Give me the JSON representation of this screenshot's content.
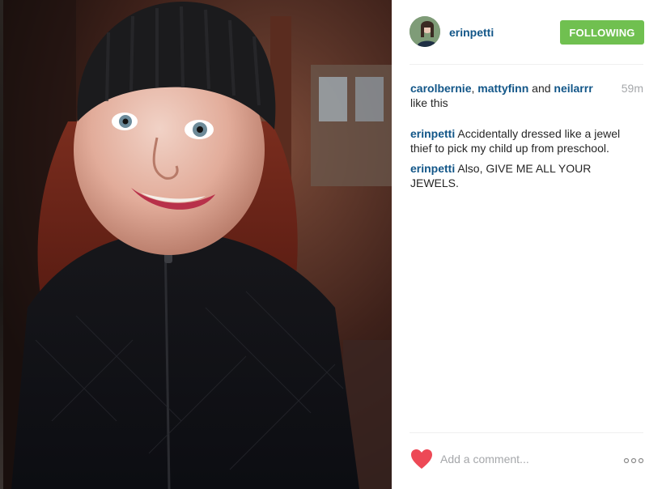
{
  "post": {
    "photo_alt": "Selfie",
    "colors": {
      "link": "#125688",
      "follow_bg": "#70c050",
      "heart": "#ed4956",
      "muted": "#a5a7aa"
    }
  },
  "header": {
    "username": "erinpetti",
    "follow_label": "FOLLOWING"
  },
  "likes": {
    "users": [
      "carolbernie",
      "mattyfinn",
      "neilarrr"
    ],
    "sep1": ", ",
    "and": " and ",
    "suffix": "like this",
    "time": "59m"
  },
  "comments": [
    {
      "user": "erinpetti",
      "text": "Accidentally dressed like a jewel thief to pick my child up from preschool."
    },
    {
      "user": "erinpetti",
      "text": "Also, GIVE ME ALL YOUR JEWELS."
    }
  ],
  "footer": {
    "comment_placeholder": "Add a comment...",
    "like_icon": "heart-icon",
    "more_icon": "more-options-icon"
  }
}
